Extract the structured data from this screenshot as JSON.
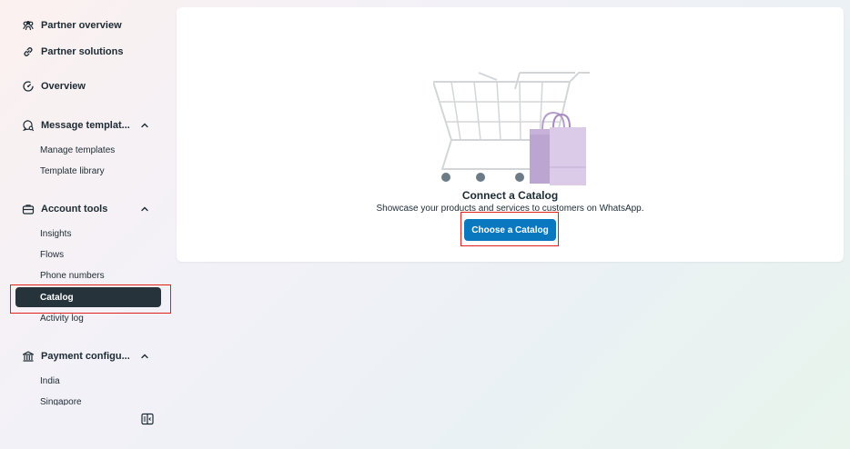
{
  "sidebar": {
    "partner_overview": "Partner overview",
    "partner_solutions": "Partner solutions",
    "overview": "Overview",
    "message_templates": {
      "label": "Message templat...",
      "items": [
        "Manage templates",
        "Template library"
      ]
    },
    "account_tools": {
      "label": "Account tools",
      "items": [
        "Insights",
        "Flows",
        "Phone numbers",
        "Catalog",
        "Activity log"
      ]
    },
    "payment_config": {
      "label": "Payment configu...",
      "items": [
        "India",
        "Singapore"
      ]
    }
  },
  "main": {
    "title": "Connect a Catalog",
    "description": "Showcase your products and services to customers on WhatsApp.",
    "button_label": "Choose a Catalog"
  },
  "colors": {
    "accent": "#0a78be",
    "active_nav": "#27333b",
    "highlight": "#e0211b"
  },
  "icons": [
    "people-icon",
    "link-icon",
    "gauge-icon",
    "chat-search-icon",
    "chevron-up-icon",
    "briefcase-icon",
    "bank-icon",
    "sidebar-collapse-icon",
    "shopping-cart-illustration"
  ]
}
